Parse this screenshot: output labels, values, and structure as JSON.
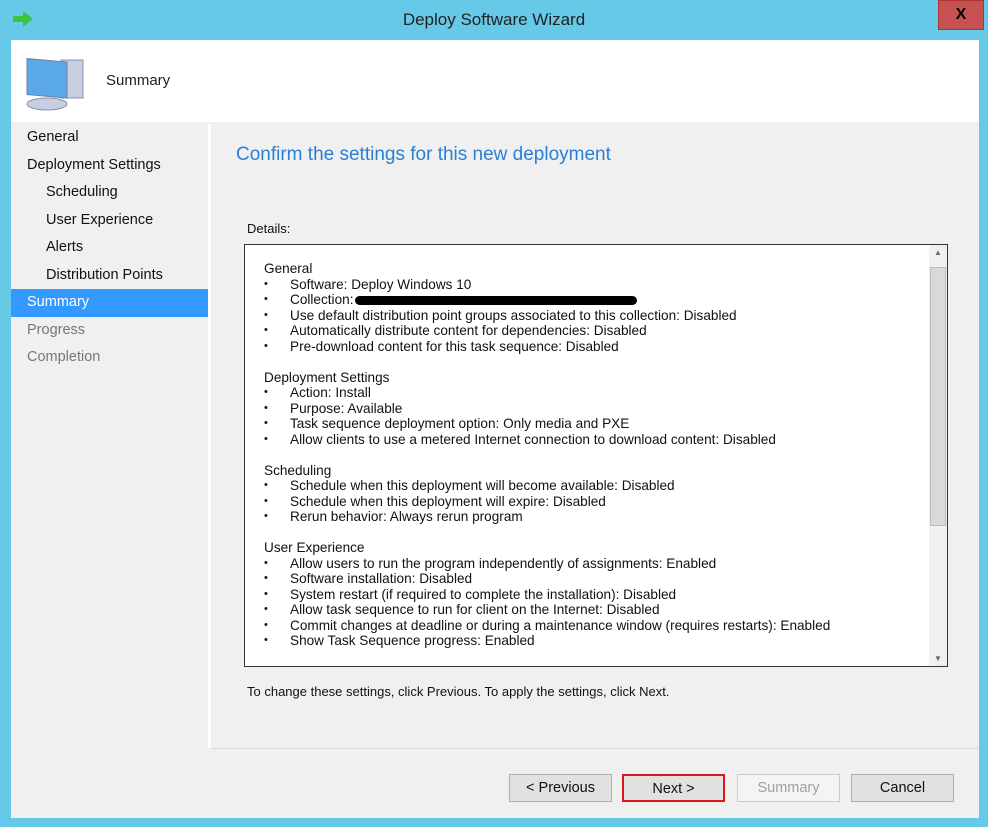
{
  "window": {
    "title": "Deploy Software Wizard",
    "close_label": "X"
  },
  "header": {
    "title": "Summary"
  },
  "nav": [
    {
      "label": "General"
    },
    {
      "label": "Deployment Settings"
    },
    {
      "label": "Scheduling"
    },
    {
      "label": "User Experience"
    },
    {
      "label": "Alerts"
    },
    {
      "label": "Distribution Points"
    },
    {
      "label": "Summary"
    },
    {
      "label": "Progress"
    },
    {
      "label": "Completion"
    }
  ],
  "main": {
    "title": "Confirm the settings for this new deployment",
    "details_label": "Details:",
    "hint": "To change these settings, click Previous. To apply the settings, click Next."
  },
  "sections": [
    {
      "heading": "General",
      "items": [
        "Software: Deploy Windows 10",
        "Collection:",
        "Use default distribution point groups associated to this collection: Disabled",
        "Automatically distribute content for dependencies: Disabled",
        "Pre-download content for this task sequence: Disabled"
      ]
    },
    {
      "heading": "Deployment Settings",
      "items": [
        "Action: Install",
        "Purpose: Available",
        "Task sequence deployment option: Only media and PXE",
        "Allow clients to use a metered Internet connection to download content: Disabled"
      ]
    },
    {
      "heading": "Scheduling",
      "items": [
        "Schedule when this deployment will become available: Disabled",
        "Schedule when this deployment will expire: Disabled",
        "Rerun behavior: Always rerun program"
      ]
    },
    {
      "heading": "User Experience",
      "items": [
        "Allow users to run the program independently of assignments: Enabled",
        "Software installation: Disabled",
        "System restart (if required to complete the installation): Disabled",
        "Allow task sequence to run for client on the Internet: Disabled",
        "Commit changes at deadline or during a maintenance window (requires restarts): Enabled",
        "Show Task Sequence progress: Enabled"
      ]
    }
  ],
  "buttons": {
    "previous": "< Previous",
    "next": "Next >",
    "summary": "Summary",
    "cancel": "Cancel"
  },
  "colors": {
    "accent": "#2a7fd4",
    "frame": "#66c9e8",
    "selected": "#3399ff",
    "highlight": "#e0141e"
  }
}
